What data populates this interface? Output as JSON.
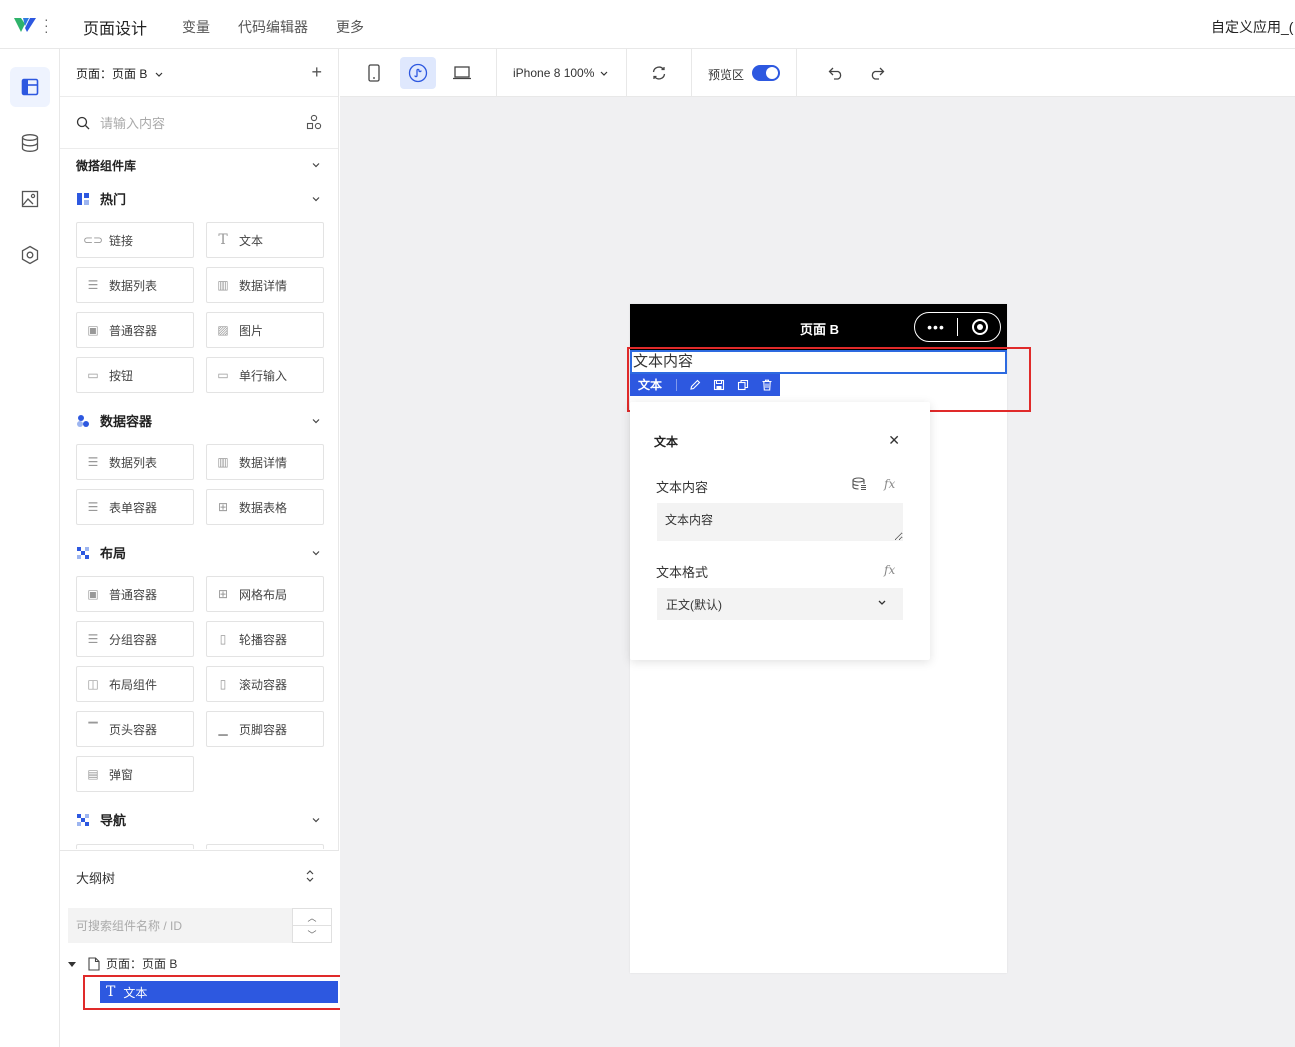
{
  "top": {
    "title": "页面设计",
    "nav": [
      "变量",
      "代码编辑器",
      "更多"
    ],
    "app_name": "自定义应用_("
  },
  "panel": {
    "page_select": "页面：页面 B",
    "search_placeholder": "请输入内容",
    "library_title": "微搭组件库",
    "categories": [
      {
        "name": "热门",
        "items": [
          "链接",
          "文本",
          "数据列表",
          "数据详情",
          "普通容器",
          "图片",
          "按钮",
          "单行输入"
        ]
      },
      {
        "name": "数据容器",
        "items": [
          "数据列表",
          "数据详情",
          "表单容器",
          "数据表格"
        ]
      },
      {
        "name": "布局",
        "items": [
          "普通容器",
          "网格布局",
          "分组容器",
          "轮播容器",
          "布局组件",
          "滚动容器",
          "页头容器",
          "页脚容器",
          "弹窗"
        ]
      },
      {
        "name": "导航",
        "items": []
      }
    ]
  },
  "outline": {
    "title": "大纲树",
    "search_placeholder": "可搜索组件名称 / ID",
    "root_label": "页面：页面 B",
    "child_label": "文本"
  },
  "toolbar": {
    "device": "iPhone 8 100%",
    "preview_label": "预览区",
    "preview_on": true
  },
  "phone": {
    "title": "页面 B",
    "text_content": "文本内容",
    "selection_label": "文本"
  },
  "popover": {
    "title": "文本",
    "field1_label": "文本内容",
    "field1_value": "文本内容",
    "field2_label": "文本格式",
    "field2_value": "正文(默认)",
    "fx": "fx"
  },
  "colors": {
    "accent": "#2d58e0",
    "highlight": "#e02a2a",
    "canvas_bg": "#f0f0f2"
  }
}
